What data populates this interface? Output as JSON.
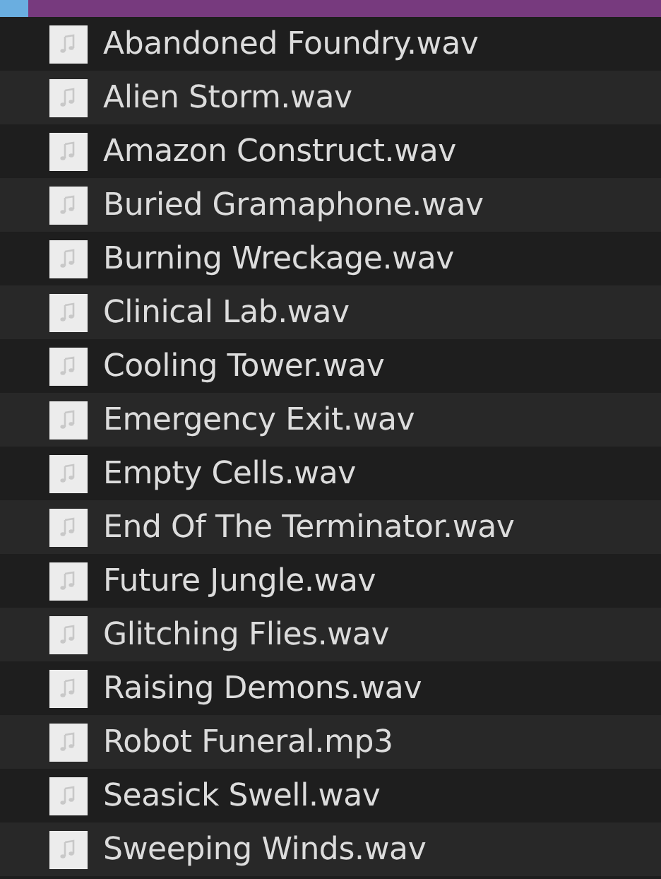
{
  "folder": {
    "selected": true
  },
  "files": [
    {
      "name": "Abandoned Foundry.wav"
    },
    {
      "name": "Alien Storm.wav"
    },
    {
      "name": "Amazon Construct.wav"
    },
    {
      "name": "Buried Gramaphone.wav"
    },
    {
      "name": "Burning Wreckage.wav"
    },
    {
      "name": "Clinical Lab.wav"
    },
    {
      "name": "Cooling Tower.wav"
    },
    {
      "name": "Emergency Exit.wav"
    },
    {
      "name": "Empty Cells.wav"
    },
    {
      "name": "End Of The Terminator.wav"
    },
    {
      "name": "Future Jungle.wav"
    },
    {
      "name": "Glitching Flies.wav"
    },
    {
      "name": "Raising Demons.wav"
    },
    {
      "name": "Robot Funeral.mp3"
    },
    {
      "name": "Seasick Swell.wav"
    },
    {
      "name": "Sweeping Winds.wav"
    }
  ]
}
